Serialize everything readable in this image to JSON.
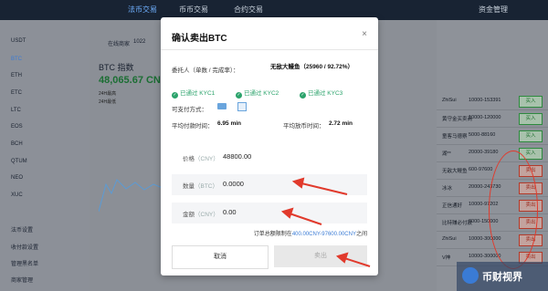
{
  "nav": {
    "items": [
      "法币交易",
      "币币交易",
      "合约交易"
    ],
    "right": "资金管理"
  },
  "sidebar": {
    "coins": [
      "USDT",
      "BTC",
      "ETH",
      "ETC",
      "LTC",
      "EOS",
      "BCH",
      "QTUM",
      "NEO",
      "XUC"
    ],
    "links": [
      "法币设置",
      "收付款设置",
      "管理黑名单",
      "商家管理"
    ]
  },
  "center": {
    "title": "BTC 指数",
    "price": "48,065.67 CNY",
    "online_label": "在线商家",
    "online_count": "1022",
    "sub1": "24H最高",
    "sub2": "24H最低"
  },
  "market": {
    "rows": [
      {
        "name": "ZhiSui",
        "range": "10000-153391",
        "action": "买入",
        "side": "buy"
      },
      {
        "name": "黄守金买卖商",
        "range": "10000-120000",
        "action": "买入",
        "side": "buy"
      },
      {
        "name": "童客马德察",
        "range": "5000-88160",
        "action": "买入",
        "side": "buy"
      },
      {
        "name": "湖**",
        "range": "20000-39180",
        "action": "买入",
        "side": "buy"
      },
      {
        "name": "无敌大鳗鱼",
        "range": "600-97600",
        "action": "卖出",
        "side": "sell"
      },
      {
        "name": "冰冰",
        "range": "20000-243730",
        "action": "卖出",
        "side": "sell"
      },
      {
        "name": "正信通好",
        "range": "10000-97202",
        "action": "卖出",
        "side": "sell"
      },
      {
        "name": "比特赚必付款",
        "range": "3000-150000",
        "action": "卖出",
        "side": "sell"
      },
      {
        "name": "ZhiSui",
        "range": "10000-300000",
        "action": "卖出",
        "side": "sell"
      },
      {
        "name": "V神",
        "range": "10000-300000",
        "action": "卖出",
        "side": "sell"
      }
    ]
  },
  "modal": {
    "title": "确认卖出BTC",
    "close": "×",
    "entrust_label": "委托人（单数 / 完成率）：",
    "entrust_value": "无敌大鳗鱼（25960 / 92.72%）",
    "kyc": [
      "已通过 KYC1",
      "已通过 KYC2",
      "已通过 KYC3"
    ],
    "pay_label": "可支付方式：",
    "avg_pay_label": "平均付款时间：",
    "avg_pay_value": "6.95 min",
    "avg_release_label": "平均放币时间：",
    "avg_release_value": "2.72 min",
    "price_label": "价格",
    "price_unit": "（CNY）",
    "price_value": "48800.00",
    "qty_label": "数量",
    "qty_unit": "（BTC）",
    "qty_value": "0.0000",
    "amt_label": "金额",
    "amt_unit": "（CNY）",
    "amt_value": "0.00",
    "limit_prefix": "订单总额限制在",
    "limit_range": "400.00CNY-97600.00CNY",
    "limit_suffix": "之间",
    "cancel": "取消",
    "confirm": "卖出"
  },
  "watermark": "币财视界"
}
